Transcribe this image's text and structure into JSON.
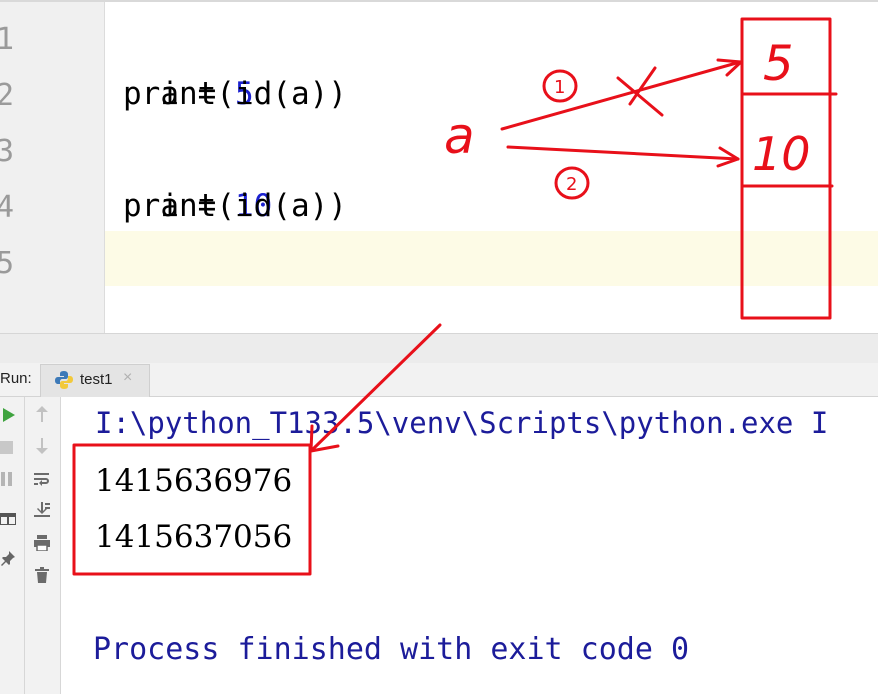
{
  "editor": {
    "line_numbers": [
      "1",
      "2",
      "3",
      "4",
      "5"
    ],
    "lines": [
      {
        "var": "a",
        "op": " = ",
        "num": "5"
      },
      {
        "text": "print(id(a))"
      },
      {
        "var": "a",
        "op": " = ",
        "num": "10"
      },
      {
        "text": "print(id(a))"
      },
      {
        "text": ""
      }
    ]
  },
  "annotation": {
    "var_label": "a",
    "step1": "①",
    "step2": "②",
    "cross": "X",
    "box_values": [
      "5",
      "10",
      "",
      ""
    ]
  },
  "run_panel": {
    "label": "Run:",
    "tab": "test1",
    "close": "×"
  },
  "console": {
    "command": "I:\\python_T133.5\\venv\\Scripts\\python.exe I",
    "outputs": [
      "1415636976",
      "1415637056"
    ],
    "finished": "Process finished with exit code 0"
  },
  "colors": {
    "annotation_red": "#e8101a",
    "number_blue": "#1c22d0",
    "console_blue": "#1c1c9a"
  },
  "icons": [
    "rerun-icon",
    "stop-icon",
    "pause-icon",
    "layout-icon",
    "pin-icon",
    "up-arrow-icon",
    "down-arrow-icon",
    "soft-wrap-icon",
    "scroll-to-end-icon",
    "print-icon",
    "trash-icon",
    "python-file-icon"
  ]
}
